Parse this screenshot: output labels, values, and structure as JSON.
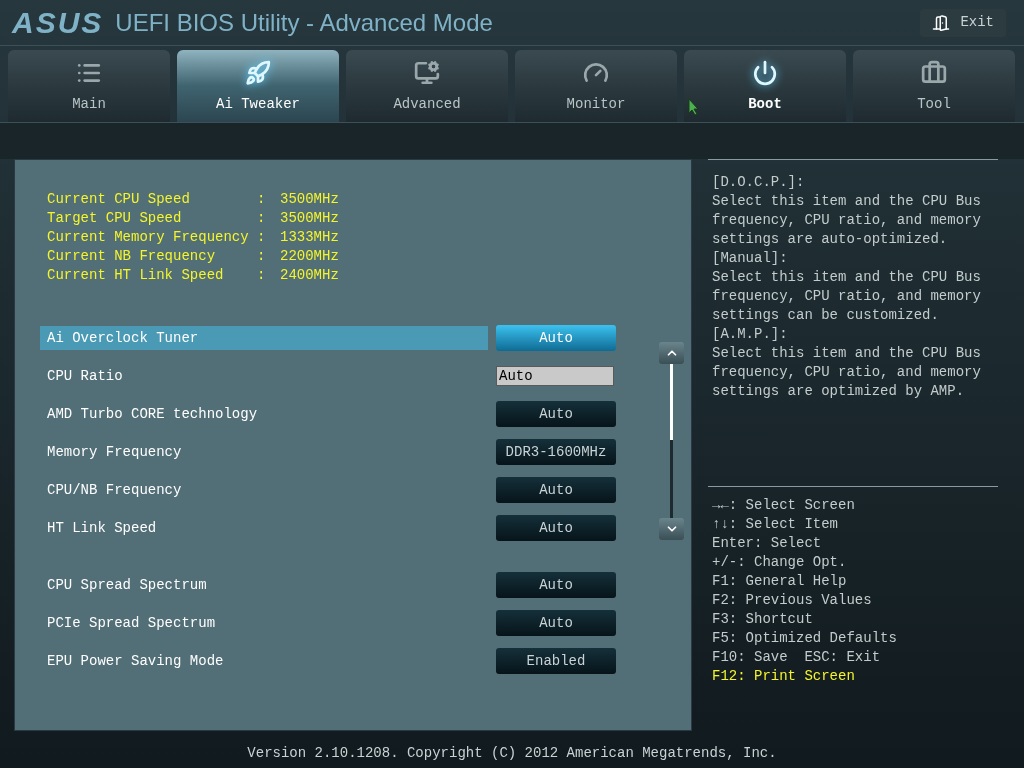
{
  "header": {
    "logo": "ASUS",
    "title": "UEFI BIOS Utility - Advanced Mode",
    "exit_label": "Exit"
  },
  "tabs": [
    {
      "label": "Main",
      "selected": false,
      "hovered": false
    },
    {
      "label": "Ai Tweaker",
      "selected": true,
      "hovered": false
    },
    {
      "label": "Advanced",
      "selected": false,
      "hovered": false
    },
    {
      "label": "Monitor",
      "selected": false,
      "hovered": false
    },
    {
      "label": "Boot",
      "selected": false,
      "hovered": true
    },
    {
      "label": "Tool",
      "selected": false,
      "hovered": false
    }
  ],
  "info": [
    {
      "label": "Current CPU Speed",
      "separator": ":",
      "value": "3500MHz"
    },
    {
      "label": "Target CPU Speed",
      "separator": ":",
      "value": "3500MHz"
    },
    {
      "label": "Current Memory Frequency",
      "separator": ":",
      "value": "1333MHz"
    },
    {
      "label": "Current NB Frequency",
      "separator": ":",
      "value": "2200MHz"
    },
    {
      "label": "Current HT Link Speed",
      "separator": ":",
      "value": "2400MHz"
    }
  ],
  "setting_groups": [
    [
      {
        "label": "Ai Overclock Tuner",
        "value": "Auto",
        "kind": "select",
        "selected": true
      },
      {
        "label": "CPU Ratio",
        "value": "Auto",
        "kind": "input",
        "selected": false
      },
      {
        "label": "AMD Turbo CORE technology",
        "value": "Auto",
        "kind": "select",
        "selected": false
      },
      {
        "label": "Memory Frequency",
        "value": "DDR3-1600MHz",
        "kind": "select",
        "selected": false
      },
      {
        "label": "CPU/NB Frequency",
        "value": "Auto",
        "kind": "select",
        "selected": false
      },
      {
        "label": "HT Link Speed",
        "value": "Auto",
        "kind": "select",
        "selected": false
      }
    ],
    [
      {
        "label": "CPU Spread Spectrum",
        "value": "Auto",
        "kind": "select",
        "selected": false
      },
      {
        "label": "PCIe Spread Spectrum",
        "value": "Auto",
        "kind": "select",
        "selected": false
      },
      {
        "label": "EPU Power Saving Mode",
        "value": "Enabled",
        "kind": "select",
        "selected": false
      }
    ]
  ],
  "help": [
    "[D.O.C.P.]:",
    "Select this item and the CPU Bus",
    "frequency, CPU ratio, and memory",
    "settings are auto-optimized.",
    "[Manual]:",
    "Select this item and the CPU Bus",
    "frequency, CPU ratio, and memory",
    "settings can be customized.",
    "[A.M.P.]:",
    "Select this item and the CPU Bus",
    "frequency, CPU ratio, and memory",
    "settings are optimized by AMP."
  ],
  "keys": [
    {
      "text": "→←: Select Screen",
      "highlight": false
    },
    {
      "text": "↑↓: Select Item",
      "highlight": false
    },
    {
      "text": "Enter: Select",
      "highlight": false
    },
    {
      "text": "+/-: Change Opt.",
      "highlight": false
    },
    {
      "text": "F1: General Help",
      "highlight": false
    },
    {
      "text": "F2: Previous Values",
      "highlight": false
    },
    {
      "text": "F3: Shortcut",
      "highlight": false
    },
    {
      "text": "F5: Optimized Defaults",
      "highlight": false
    },
    {
      "text": "F10: Save  ESC: Exit",
      "highlight": false
    },
    {
      "text": "F12: Print Screen",
      "highlight": true
    }
  ],
  "footer": "Version 2.10.1208. Copyright (C) 2012 American Megatrends, Inc."
}
